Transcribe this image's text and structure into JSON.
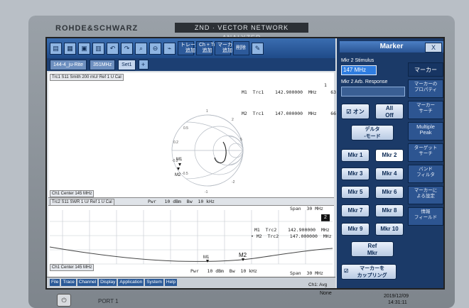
{
  "device": {
    "brand": "ROHDE&SCHWARZ",
    "model": "ZND · VECTOR NETWORK ANALYZER",
    "port_label": "PORT 1"
  },
  "toolbar": {
    "trace_add_label": "トレース\n追加",
    "ch_tr_label": "Ch + Tr\n追加",
    "marker_add_label": "マーカー\n追加",
    "delete_label": "削除"
  },
  "tabs": [
    "144-4_ju-Rite",
    "351MHz",
    "Set1"
  ],
  "trace1": {
    "header": "Trc1   S11  Smith 200 mU/ Ref 1 U  Cal",
    "index": "1",
    "footer": "Ch1  Center 145 MHz",
    "marker1": "M1  Trc1    142.900000  MHz     63.403  Ω\n                                    j26.241  Ω\n                                    42.444  pF",
    "marker2": "M2  Trc1    147.000000  MHz     66.768  Ω\n                                   -j10.867  Ω\n                                    99.633  pF",
    "pwr_bw": "Pwr   10 dBm  Bw  10 kHz",
    "span": "Span  30 MHz",
    "m_labels": [
      "M1",
      "M2"
    ]
  },
  "trace2": {
    "header": "Trc2   S11  SWR  1 U/ Ref 1 U  Cal",
    "index": "2",
    "marker1": "M1  Trc2    142.900000  MHz   1.678  U",
    "marker2": "• M2  Trc2    147.000000  MHz   1.411  U",
    "footer": "Ch1  Center 145 MHz",
    "pwr_bw": "Pwr   10 dBm  Bw  10 kHz",
    "span": "Span  30 MHz",
    "m_labels": [
      "M1",
      "M2"
    ]
  },
  "menu": [
    "File",
    "Trace",
    "Channel",
    "Display",
    "Application",
    "System",
    "Help"
  ],
  "status": {
    "ch": "Ch1:  Avg",
    "avg": "None",
    "date": "2019/12/09",
    "time": "14:31:11"
  },
  "marker_panel": {
    "title": "Marker",
    "close": "X",
    "stimulus_label": "Mkr 2 Stimulus",
    "stimulus_value": "147 MHz",
    "arb_label": "Mkr 2 Arb. Response",
    "on_label": "オン",
    "all_off_label": "All\nOff",
    "delta_label": "デルタ\n-モード",
    "buttons": [
      "Mkr 1",
      "Mkr 2",
      "Mkr 3",
      "Mkr 4",
      "Mkr 5",
      "Mkr 6",
      "Mkr 7",
      "Mkr 8",
      "Mkr 9",
      "Mkr 10"
    ],
    "ref_label": "Ref\nMkr",
    "coupling_label": "マーカーを\nカップリング",
    "right_tabs": [
      "マーカー",
      "マーカーの\nプロパティ",
      "マーカー\nサーチ",
      "Multiple\nPeak",
      "ターゲット\nサーチ",
      "バンド\nフィルタ",
      "マーカーに\nよる設定",
      "情報\nフィールド"
    ]
  },
  "smith_ticks": [
    "0.5",
    "0.2",
    "1",
    "2",
    "5",
    "-0.2",
    "-0.5",
    "-1",
    "-2"
  ]
}
